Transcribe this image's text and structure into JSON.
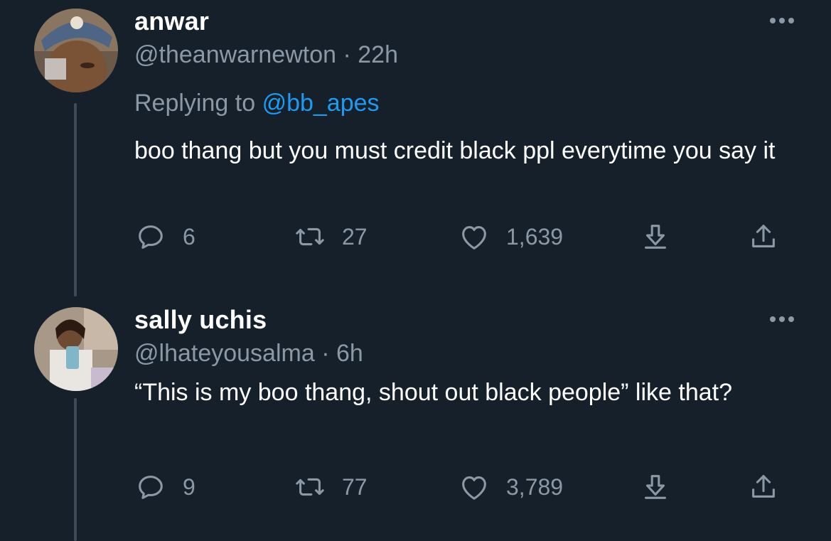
{
  "tweets": [
    {
      "display_name": "anwar",
      "handle": "@theanwarnewton",
      "separator": "·",
      "time": "22h",
      "replying_prefix": "Replying to",
      "replying_to": "@bb_apes",
      "text": "boo thang but you must credit black ppl everytime you say it",
      "reply_count": "6",
      "retweet_count": "27",
      "like_count": "1,639"
    },
    {
      "display_name": "sally uchis",
      "handle": "@lhateyousalma",
      "separator": "·",
      "time": "6h",
      "text": "“This is my boo thang, shout out black people” like that?",
      "reply_count": "9",
      "retweet_count": "77",
      "like_count": "3,789"
    }
  ],
  "icons": {
    "reply": "reply-icon",
    "retweet": "retweet-icon",
    "like": "heart-icon",
    "download": "download-icon",
    "share": "share-icon",
    "more": "more-dots-icon"
  },
  "colors": {
    "background": "#15202b",
    "primary_text": "#ffffff",
    "secondary_text": "#8b98a5",
    "link": "#1d9bf0",
    "thread_line": "#3d4a57"
  }
}
